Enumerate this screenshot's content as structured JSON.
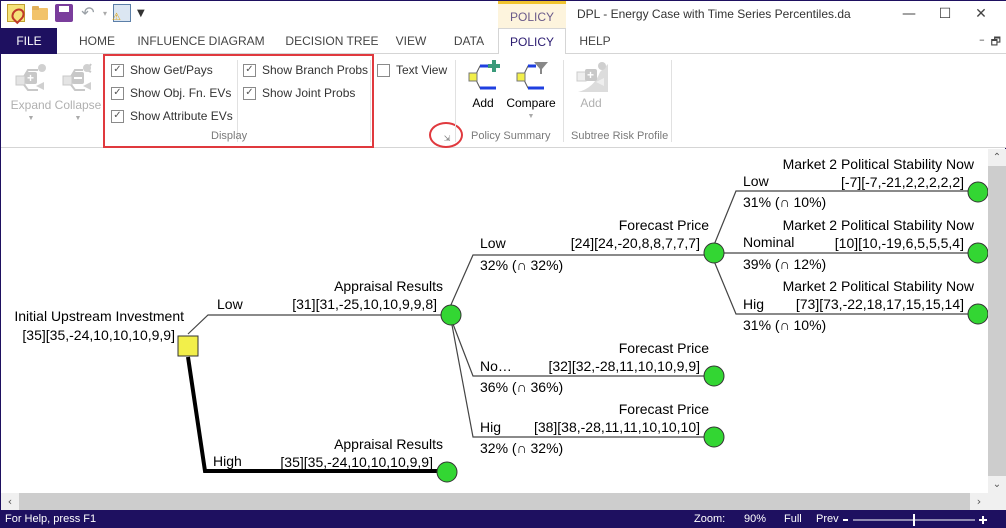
{
  "window": {
    "title": "DPL - Energy Case with Time Series Percentiles.da",
    "context_tab_label": "POLICY",
    "minimize": "—",
    "maximize": "☐",
    "close": "✕",
    "mdi_minimize": "–",
    "mdi_restore": "🗗"
  },
  "quick_access": {
    "icons": [
      "app-icon",
      "open-folder-icon",
      "save-icon",
      "undo-icon",
      "calculator-warning-icon",
      "customize-qat-icon"
    ],
    "undo_glyph": "↶",
    "dropdown_glyph": "▾",
    "customize_glyph": "▼"
  },
  "tabs": [
    {
      "label": "FILE",
      "active": false
    },
    {
      "label": "HOME",
      "active": false
    },
    {
      "label": "INFLUENCE DIAGRAM",
      "active": false
    },
    {
      "label": "DECISION TREE",
      "active": false
    },
    {
      "label": "VIEW",
      "active": false
    },
    {
      "label": "DATA",
      "active": false
    },
    {
      "label": "POLICY",
      "active": true
    },
    {
      "label": "HELP",
      "active": false
    }
  ],
  "ribbon": {
    "expand": {
      "label": "Expand",
      "enabled": false
    },
    "collapse": {
      "label": "Collapse",
      "enabled": false
    },
    "display": {
      "group_label": "Display",
      "checkboxes": [
        {
          "label": "Show Get/Pays",
          "checked": true
        },
        {
          "label": "Show Obj. Fn. EVs",
          "checked": true
        },
        {
          "label": "Show Attribute EVs",
          "checked": true
        },
        {
          "label": "Show Branch Probs",
          "checked": true
        },
        {
          "label": "Show Joint Probs",
          "checked": true
        }
      ],
      "check_glyph": "✓"
    },
    "text_view": {
      "label": "Text View",
      "checked": false
    },
    "launcher_glyph": "⇲",
    "policy_summary": {
      "group_label": "Policy Summary",
      "add_label": "Add",
      "compare_label": "Compare"
    },
    "subtree_risk_profile": {
      "group_label": "Subtree Risk Profile",
      "add_label": "Add",
      "enabled": false
    }
  },
  "tree": {
    "root": {
      "name": "Initial Upstream Investment",
      "value": "[35][35,-24,10,10,10,9,9]",
      "type": "decision"
    },
    "branches": [
      {
        "label": "Low",
        "node_name": "Appraisal Results",
        "value": "[31][31,-25,10,10,9,9,8]",
        "optimal": false,
        "children": [
          {
            "label": "Low",
            "prob": "32% (∩ 32%)",
            "node_name": "Forecast Price",
            "value": "[24][24,-20,8,8,7,7,7]",
            "children": [
              {
                "label": "Low",
                "prob": "31% (∩ 10%)",
                "node_name": "Market 2 Political Stability Now",
                "value": "[-7][-7,-21,2,2,2,2,2]"
              },
              {
                "label": "Nominal",
                "prob": "39% (∩ 12%)",
                "node_name": "Market 2 Political Stability Now",
                "value": "[10][10,-19,6,5,5,5,4]"
              },
              {
                "label": "Hig",
                "prob": "31% (∩ 10%)",
                "node_name": "Market 2 Political Stability Now",
                "value": "[73][73,-22,18,17,15,15,14]"
              }
            ]
          },
          {
            "label": "No…",
            "prob": "36% (∩ 36%)",
            "node_name": "Forecast Price",
            "value": "[32][32,-28,11,10,10,9,9]"
          },
          {
            "label": "Hig",
            "prob": "32% (∩ 32%)",
            "node_name": "Forecast Price",
            "value": "[38][38,-28,11,11,10,10,10]"
          }
        ]
      },
      {
        "label": "High",
        "node_name": "Appraisal Results",
        "value": "[35][35,-24,10,10,10,9,9]",
        "optimal": true
      }
    ],
    "colors": {
      "decision_fill": "#f2ef4a",
      "chance_fill": "#33d633",
      "line": "#444444",
      "optimal_line": "#000000"
    }
  },
  "scrollbars": {
    "up": "⌃",
    "down": "⌄",
    "left": "‹",
    "right": "›"
  },
  "status": {
    "help_text": "For Help, press F1",
    "zoom_label": "Zoom:",
    "zoom_value": "90%",
    "full_label": "Full",
    "prev_label": "Prev",
    "zoom_minus": "-",
    "zoom_plus": "+",
    "zoom_slider_fraction": 0.5
  }
}
